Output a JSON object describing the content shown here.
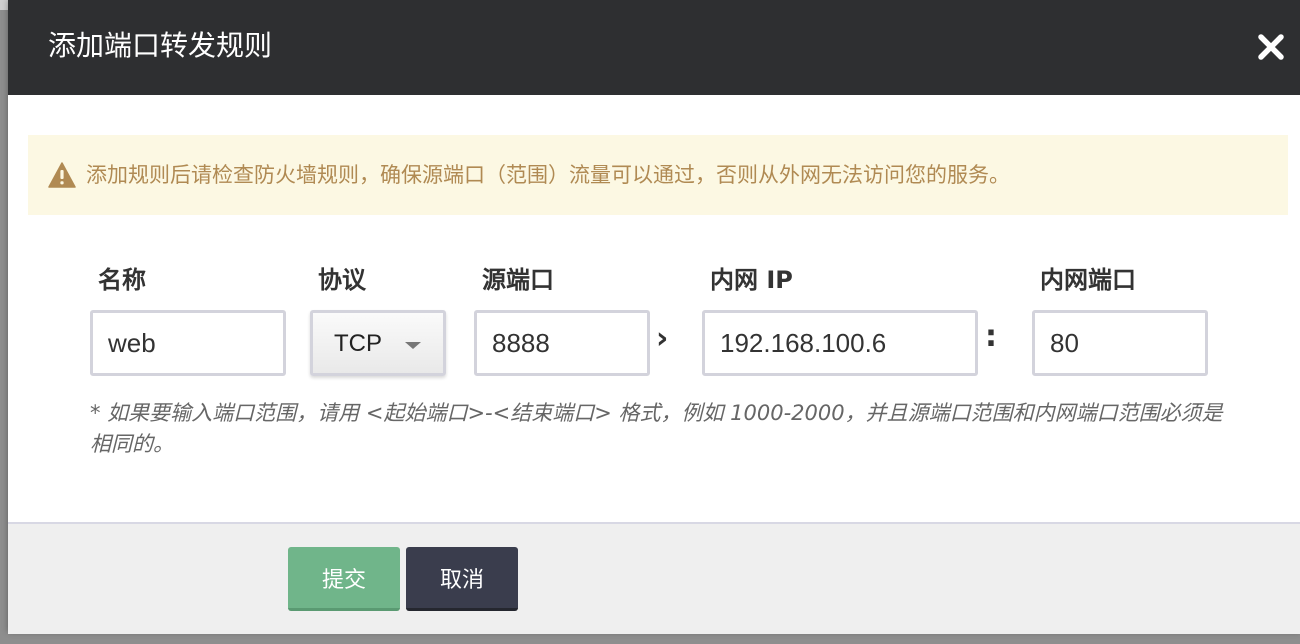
{
  "dialog": {
    "title": "添加端口转发规则",
    "close_icon": "close-icon"
  },
  "warning": {
    "icon": "warning-triangle-icon",
    "text": "添加规则后请检查防火墙规则，确保源端口（范围）流量可以通过，否则从外网无法访问您的服务。",
    "color": "#b08a53",
    "background": "#fcf8e3"
  },
  "form": {
    "name": {
      "label": "名称",
      "value": "web"
    },
    "protocol": {
      "label": "协议",
      "value": "TCP"
    },
    "source_port": {
      "label": "源端口",
      "value": "8888"
    },
    "arrow": "›",
    "internal_ip": {
      "label": "内网 IP",
      "value": "192.168.100.6"
    },
    "colon": ":",
    "internal_port": {
      "label": "内网端口",
      "value": "80"
    },
    "hint": "* 如果要输入端口范围，请用 <起始端口>-<结束端口> 格式，例如 1000-2000，并且源端口范围和内网端口范围必须是相同的。"
  },
  "footer": {
    "submit_label": "提交",
    "cancel_label": "取消",
    "submit_color": "#70b58a",
    "cancel_color": "#3a3d4d"
  }
}
